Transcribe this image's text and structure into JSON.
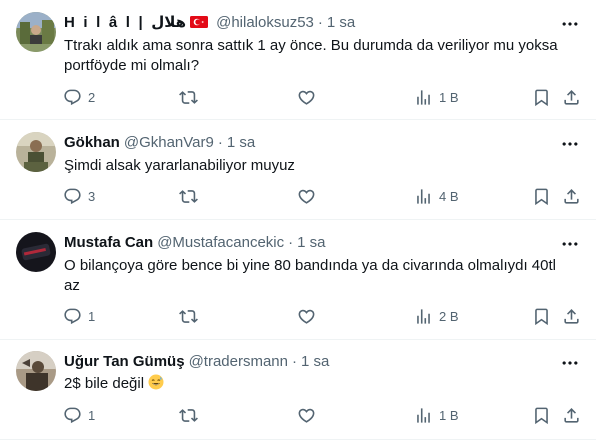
{
  "replies": [
    {
      "name": "H i l â l | هلال",
      "handle": "@hilaloksuz53",
      "time": "1 sa",
      "text": "Ttrakı aldık ama sonra sattık 1 ay önce. Bu durumda da veriliyor mu yoksa portföyde mi olmalı?",
      "replies_count": "2",
      "retweets_count": "",
      "likes_count": "",
      "views": "1 B"
    },
    {
      "name": "Gökhan",
      "handle": "@GkhanVar9",
      "time": "1 sa",
      "text": "Şimdi alsak yararlanabiliyor muyuz",
      "replies_count": "3",
      "retweets_count": "",
      "likes_count": "",
      "views": "4 B"
    },
    {
      "name": "Mustafa Can",
      "handle": "@Mustafacancekic",
      "time": "1 sa",
      "text": "O bilançoya göre bence bi yine 80 bandında ya da civarında olmalıydı 40tl az",
      "replies_count": "1",
      "retweets_count": "",
      "likes_count": "",
      "views": "2 B"
    },
    {
      "name": "Uğur Tan Gümüş",
      "handle": "@tradersmann",
      "time": "1 sa",
      "text": "2$ bile değil",
      "replies_count": "1",
      "retweets_count": "",
      "likes_count": "",
      "views": "1 B"
    }
  ],
  "icons": {
    "reply": "speech-bubble-icon",
    "retweet": "retweet-icon",
    "like": "heart-icon",
    "views": "bar-chart-icon",
    "bookmark": "bookmark-icon",
    "share": "share-icon",
    "more": "more-dots-icon",
    "flag": "turkey-flag-icon",
    "emoji": "sweat-smile-emoji-icon"
  },
  "colors": {
    "text": "#0f1419",
    "secondary": "#536471",
    "divider": "#eff3f4",
    "flag_red": "#e30a17"
  }
}
